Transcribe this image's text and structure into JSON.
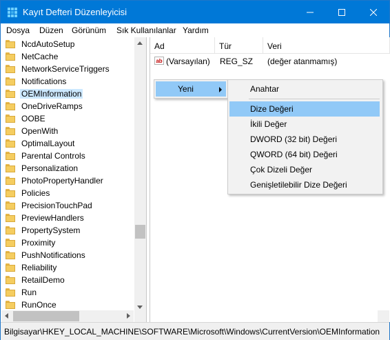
{
  "window": {
    "title": "Kayıt Defteri Düzenleyicisi",
    "accent": "#0078d7"
  },
  "menubar": [
    "Dosya",
    "Düzen",
    "Görünüm",
    "Sık Kullanılanlar",
    "Yardım"
  ],
  "tree": {
    "items": [
      "NcdAutoSetup",
      "NetCache",
      "NetworkServiceTriggers",
      "Notifications",
      "OEMInformation",
      "OneDriveRamps",
      "OOBE",
      "OpenWith",
      "OptimalLayout",
      "Parental Controls",
      "Personalization",
      "PhotoPropertyHandler",
      "Policies",
      "PrecisionTouchPad",
      "PreviewHandlers",
      "PropertySystem",
      "Proximity",
      "PushNotifications",
      "Reliability",
      "RetailDemo",
      "Run",
      "RunOnce"
    ],
    "selected": "OEMInformation"
  },
  "list": {
    "columns": [
      "Ad",
      "Tür",
      "Veri"
    ],
    "rows": [
      {
        "name": "(Varsayılan)",
        "type": "REG_SZ",
        "data": "(değer atanmamış)",
        "icon": "ab-icon"
      }
    ]
  },
  "context_menu": {
    "new_label": "Yeni"
  },
  "submenu": {
    "key": "Anahtar",
    "items": [
      "Dize Değeri",
      "İkili Değer",
      "DWORD (32 bit) Değeri",
      "QWORD (64 bit) Değeri",
      "Çok Dizeli Değer",
      "Genişletilebilir Dize Değeri"
    ],
    "highlighted": "Dize Değeri",
    "highlight_color": "#91c9f7"
  },
  "statusbar": {
    "path": "Bilgisayar\\HKEY_LOCAL_MACHINE\\SOFTWARE\\Microsoft\\Windows\\CurrentVersion\\OEMInformation"
  }
}
